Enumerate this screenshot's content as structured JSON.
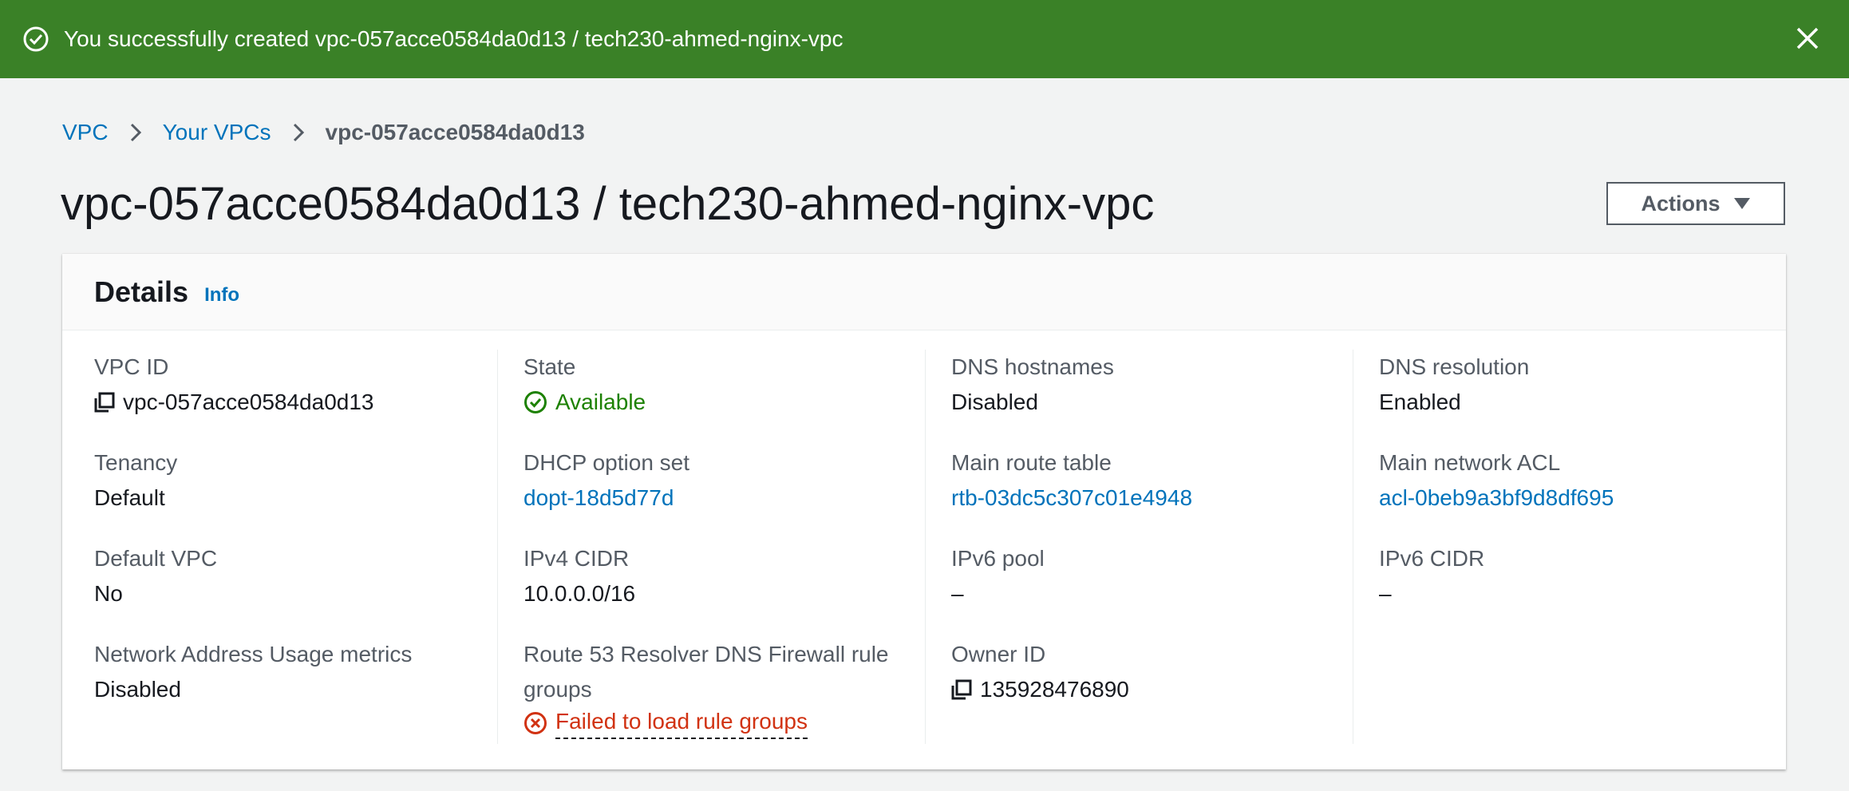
{
  "flash": {
    "message": "You successfully created vpc-057acce0584da0d13 / tech230-ahmed-nginx-vpc",
    "color": "#3a8127"
  },
  "breadcrumb": {
    "items": [
      "VPC",
      "Your VPCs"
    ],
    "current": "vpc-057acce0584da0d13"
  },
  "header": {
    "title": "vpc-057acce0584da0d13 / tech230-ahmed-nginx-vpc",
    "actions_label": "Actions"
  },
  "details": {
    "title": "Details",
    "info_label": "Info",
    "columns": [
      [
        {
          "label": "VPC ID",
          "value": "vpc-057acce0584da0d13"
        },
        {
          "label": "Tenancy",
          "value": "Default"
        },
        {
          "label": "Default VPC",
          "value": "No"
        },
        {
          "label": "Network Address Usage metrics",
          "value": "Disabled"
        }
      ],
      [
        {
          "label": "State",
          "value": "Available"
        },
        {
          "label": "DHCP option set",
          "value": "dopt-18d5d77d"
        },
        {
          "label": "IPv4 CIDR",
          "value": "10.0.0.0/16"
        },
        {
          "label": "Route 53 Resolver DNS Firewall rule groups",
          "value": "Failed to load rule groups"
        }
      ],
      [
        {
          "label": "DNS hostnames",
          "value": "Disabled"
        },
        {
          "label": "Main route table",
          "value": "rtb-03dc5c307c01e4948"
        },
        {
          "label": "IPv6 pool",
          "value": "–"
        },
        {
          "label": "Owner ID",
          "value": "135928476890"
        }
      ],
      [
        {
          "label": "DNS resolution",
          "value": "Enabled"
        },
        {
          "label": "Main network ACL",
          "value": "acl-0beb9a3bf9d8df695"
        },
        {
          "label": "IPv6 CIDR",
          "value": "–"
        }
      ]
    ]
  }
}
